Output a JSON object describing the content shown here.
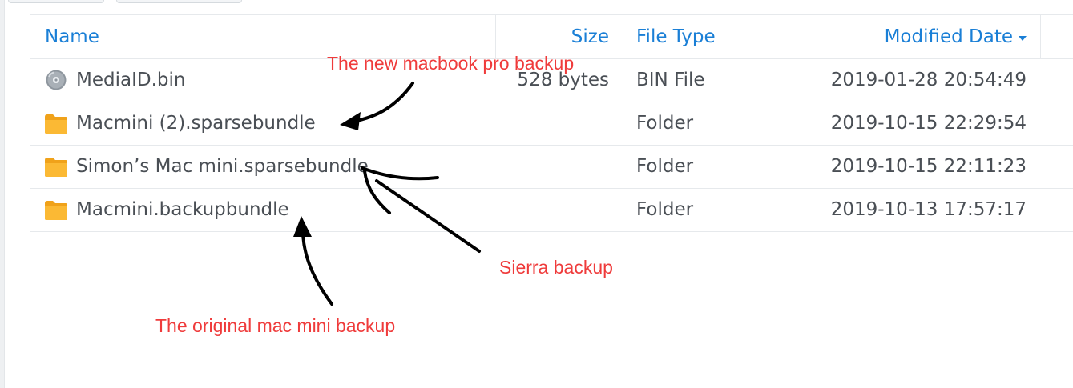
{
  "header": {
    "name": "Name",
    "size": "Size",
    "file_type": "File Type",
    "modified_date": "Modified Date"
  },
  "rows": [
    {
      "icon": "disk-image-icon",
      "name": "MediaID.bin",
      "size": "528 bytes",
      "type": "BIN File",
      "date": "2019-01-28 20:54:49"
    },
    {
      "icon": "folder-icon",
      "name": "Macmini (2).sparsebundle",
      "size": "",
      "type": "Folder",
      "date": "2019-10-15 22:29:54"
    },
    {
      "icon": "folder-icon",
      "name": "Simon’s Mac mini.sparsebundle",
      "size": "",
      "type": "Folder",
      "date": "2019-10-15 22:11:23"
    },
    {
      "icon": "folder-icon",
      "name": "Macmini.backupbundle",
      "size": "",
      "type": "Folder",
      "date": "2019-10-13 17:57:17"
    }
  ],
  "annotations": {
    "new_macbook": "The new macbook pro backup",
    "sierra": "Sierra backup",
    "original": "The original mac mini backup"
  },
  "colors": {
    "header_text": "#1a7fd6",
    "annotation": "#ef3b3b",
    "folder": "#f5a623"
  }
}
